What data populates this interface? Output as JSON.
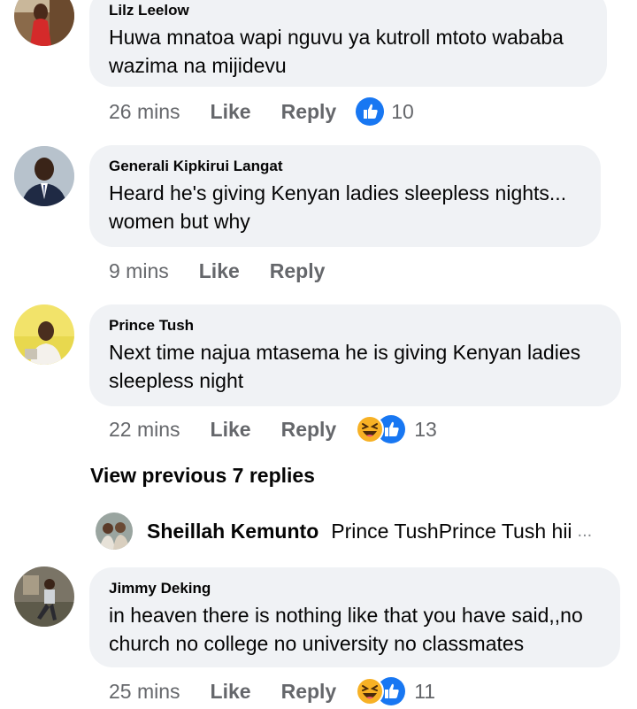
{
  "comments": [
    {
      "author": "Lilz Leelow",
      "text_lines": [
        "Huwa mnatoa wapi nguvu ya kutroll mtoto wababa",
        "wazima na mijidevu"
      ],
      "time": "26 mins",
      "like_label": "Like",
      "reply_label": "Reply",
      "reactions": [
        "like-icon"
      ],
      "reaction_count": "10"
    },
    {
      "author": "Generali Kipkirui Langat",
      "text_lines": [
        "Heard he's giving Kenyan ladies sleepless nights...",
        "women but why"
      ],
      "time": "9 mins",
      "like_label": "Like",
      "reply_label": "Reply"
    },
    {
      "author": "Prince Tush",
      "text_lines": [
        "Next time najua mtasema he is giving Kenyan ladies",
        "sleepless night"
      ],
      "time": "22 mins",
      "like_label": "Like",
      "reply_label": "Reply",
      "reactions": [
        "haha-icon",
        "like-icon"
      ],
      "reaction_count": "13"
    },
    {
      "author": "Jimmy Deking",
      "text_lines": [
        "in heaven there is nothing like that you have said,,no",
        "church no college no university no classmates"
      ],
      "time": "25 mins",
      "like_label": "Like",
      "reply_label": "Reply",
      "reactions": [
        "haha-icon",
        "like-icon"
      ],
      "reaction_count": "11"
    }
  ],
  "view_previous": "View previous 7 replies",
  "reply_preview": {
    "author": "Sheillah Kemunto",
    "text": "Prince TushPrince Tush hii",
    "ellipsis": "..."
  },
  "colors": {
    "bubble": "#f0f2f5",
    "meta_text": "#65676b",
    "like_blue": "#1877f2",
    "haha_yellow": "#f7b125"
  }
}
